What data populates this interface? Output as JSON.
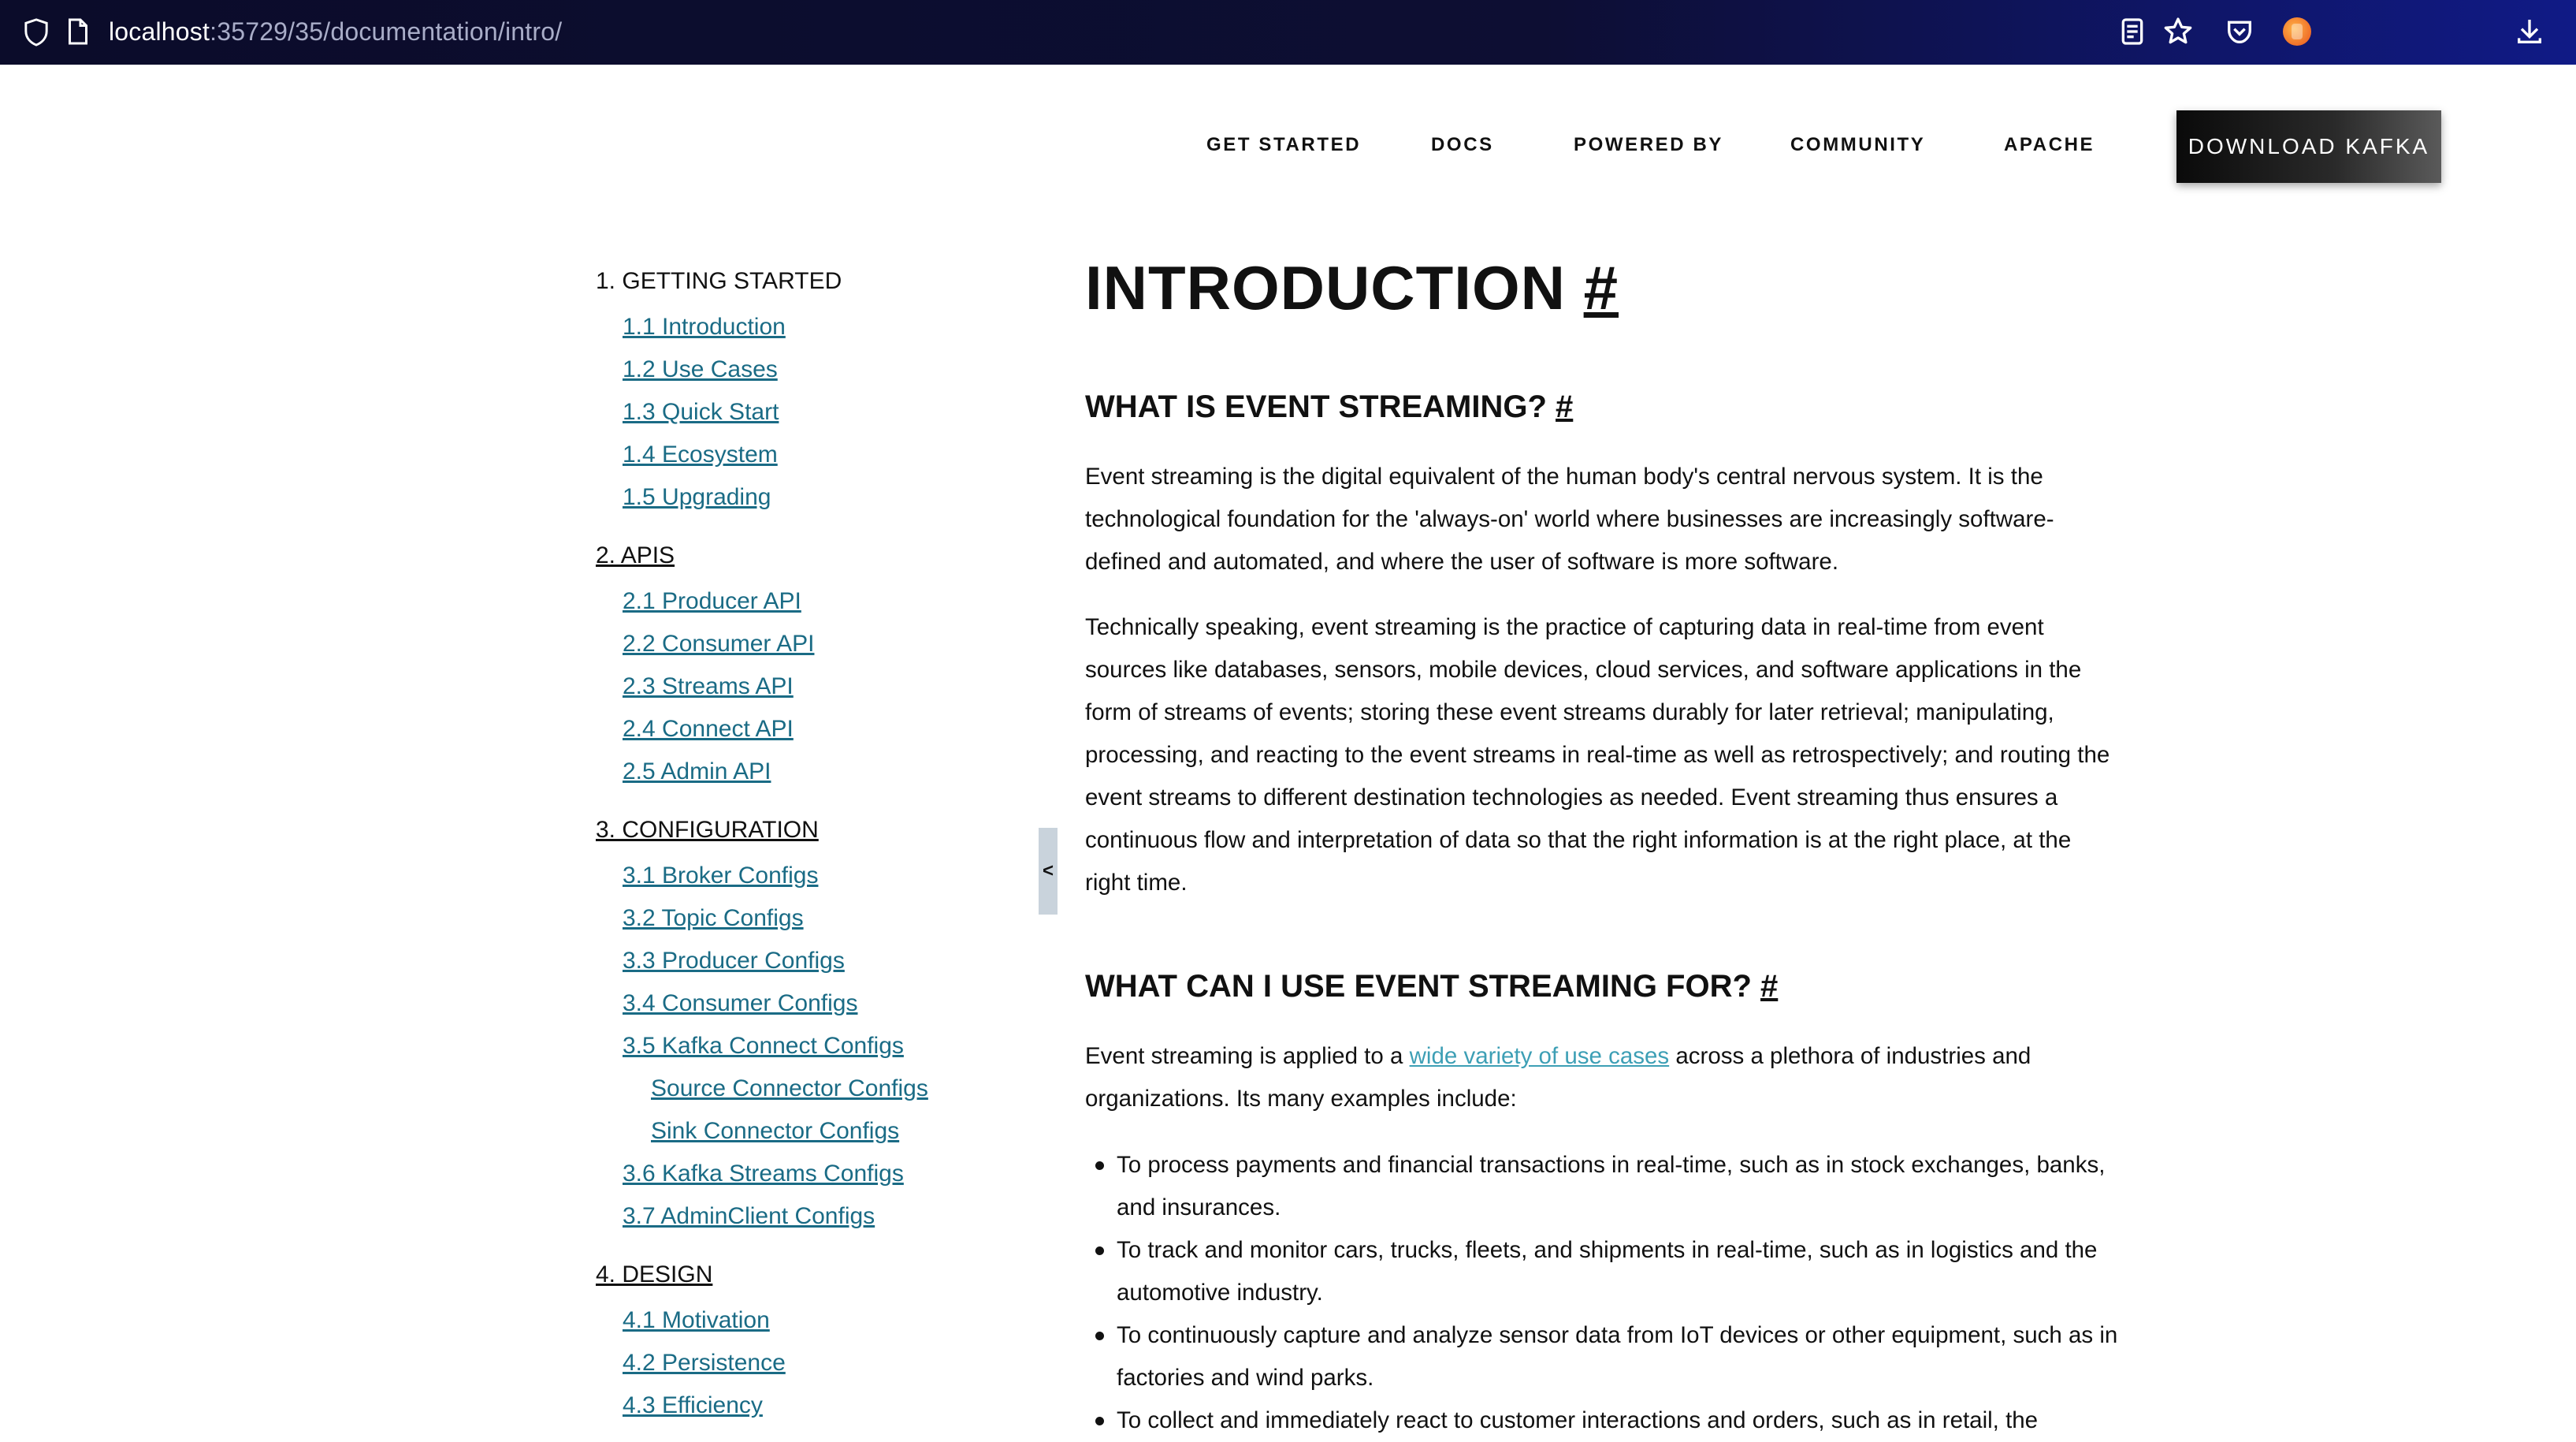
{
  "browser": {
    "url_host": "localhost",
    "url_path": ":35729/35/documentation/intro/",
    "icons": [
      "shield-icon",
      "page-icon",
      "reader-mode-icon",
      "bookmark-star-icon",
      "pocket-icon",
      "extension-icon",
      "download-icon"
    ]
  },
  "nav": {
    "items": [
      "GET STARTED",
      "DOCS",
      "POWERED BY",
      "COMMUNITY",
      "APACHE"
    ],
    "download_label": "DOWNLOAD KAFKA"
  },
  "sidebar": {
    "sections": [
      {
        "label": "1. GETTING STARTED",
        "links": [
          "1.1 Introduction",
          "1.2 Use Cases",
          "1.3 Quick Start",
          "1.4 Ecosystem",
          "1.5 Upgrading"
        ]
      },
      {
        "label": "2. APIS",
        "links": [
          "2.1 Producer API",
          "2.2 Consumer API",
          "2.3 Streams API",
          "2.4 Connect API",
          "2.5 Admin API"
        ]
      },
      {
        "label": "3. CONFIGURATION",
        "links": [
          "3.1 Broker Configs",
          "3.2 Topic Configs",
          "3.3 Producer Configs",
          "3.4 Consumer Configs",
          "3.5 Kafka Connect Configs",
          "Source Connector Configs",
          "Sink Connector Configs",
          "3.6 Kafka Streams Configs",
          "3.7 AdminClient Configs"
        ]
      },
      {
        "label": "4. DESIGN",
        "links": [
          "4.1 Motivation",
          "4.2 Persistence",
          "4.3 Efficiency"
        ]
      }
    ],
    "collapse_label": "<"
  },
  "content": {
    "title": "INTRODUCTION",
    "anchor": "#",
    "h_what_is": "WHAT IS EVENT STREAMING?",
    "p1": "Event streaming is the digital equivalent of the human body's central nervous system. It is the technological foundation for the 'always-on' world where businesses are increasingly software-defined and automated, and where the user of software is more software.",
    "p2": "Technically speaking, event streaming is the practice of capturing data in real-time from event sources like databases, sensors, mobile devices, cloud services, and software applications in the form of streams of events; storing these event streams durably for later retrieval; manipulating, processing, and reacting to the event streams in real-time as well as retrospectively; and routing the event streams to different destination technologies as needed. Event streaming thus ensures a continuous flow and interpretation of data so that the right information is at the right place, at the right time.",
    "h_use_for": "WHAT CAN I USE EVENT STREAMING FOR?",
    "p3_before": "Event streaming is applied to a ",
    "p3_link": "wide variety of use cases",
    "p3_after": " across a plethora of industries and organizations. Its many examples include:",
    "uses": [
      "To process payments and financial transactions in real-time, such as in stock exchanges, banks, and insurances.",
      "To track and monitor cars, trucks, fleets, and shipments in real-time, such as in logistics and the automotive industry.",
      "To continuously capture and analyze sensor data from IoT devices or other equipment, such as in factories and wind parks.",
      "To collect and immediately react to customer interactions and orders, such as in retail, the"
    ]
  }
}
